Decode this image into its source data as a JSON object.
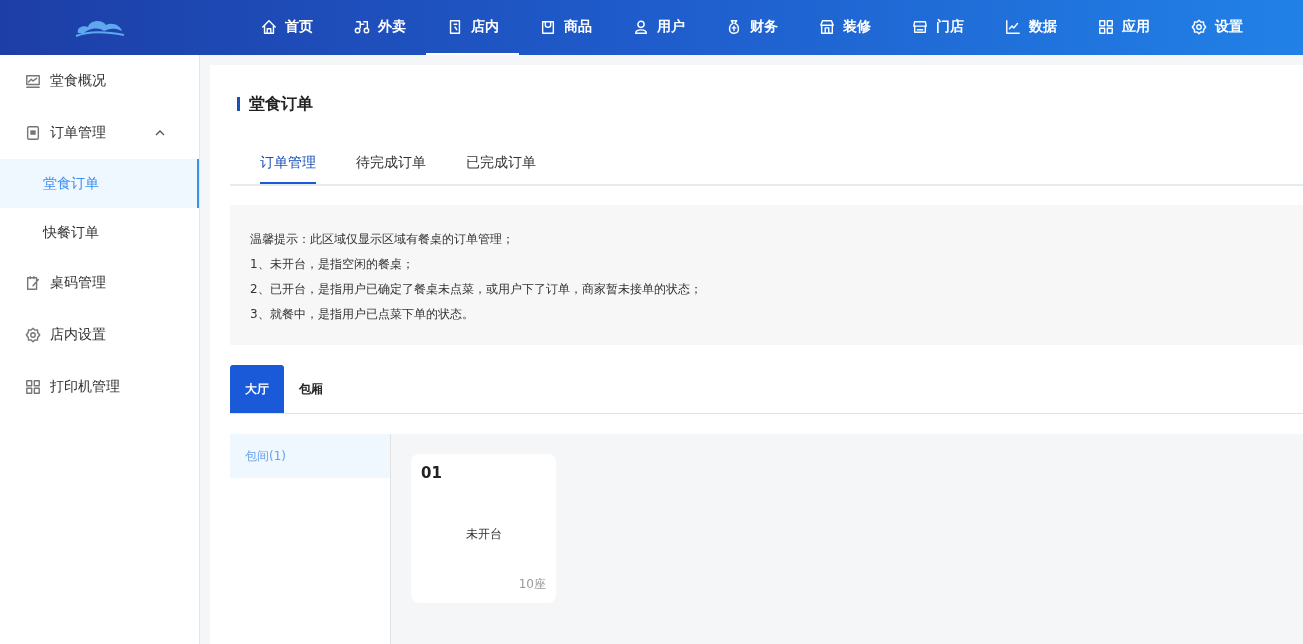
{
  "top_nav": [
    {
      "label": "首页",
      "selected": false
    },
    {
      "label": "外卖",
      "selected": false
    },
    {
      "label": "店内",
      "selected": true
    },
    {
      "label": "商品",
      "selected": false
    },
    {
      "label": "用户",
      "selected": false
    },
    {
      "label": "财务",
      "selected": false
    },
    {
      "label": "装修",
      "selected": false
    },
    {
      "label": "门店",
      "selected": false
    },
    {
      "label": "数据",
      "selected": false
    },
    {
      "label": "应用",
      "selected": false
    },
    {
      "label": "设置",
      "selected": false
    }
  ],
  "sidebar": {
    "items": [
      {
        "label": "堂食概况",
        "selected": false
      },
      {
        "label": "订单管理",
        "expanded": true,
        "children": [
          {
            "label": "堂食订单",
            "selected": true
          },
          {
            "label": "快餐订单",
            "selected": false
          }
        ]
      },
      {
        "label": "桌码管理",
        "selected": false
      },
      {
        "label": "店内设置",
        "selected": false
      },
      {
        "label": "打印机管理",
        "selected": false
      }
    ]
  },
  "page_title": "堂食订单",
  "tabs": [
    {
      "label": "订单管理",
      "selected": true
    },
    {
      "label": "待完成订单",
      "selected": false
    },
    {
      "label": "已完成订单",
      "selected": false
    }
  ],
  "notice": [
    "温馨提示：此区域仅显示区域有餐桌的订单管理；",
    "1、未开台，是指空闲的餐桌；",
    "2、已开台，是指用户已确定了餐桌未点菜，或用户下了订单，商家暂未接单的状态；",
    "3、就餐中，是指用户已点菜下单的状态。"
  ],
  "area_tabs": [
    {
      "label": "大厅",
      "selected": true
    },
    {
      "label": "包厢",
      "selected": false
    }
  ],
  "rooms": [
    {
      "label": "包间(1)",
      "selected": true
    }
  ],
  "tables": [
    {
      "number": "01",
      "status": "未开台",
      "seats": "10座"
    }
  ]
}
